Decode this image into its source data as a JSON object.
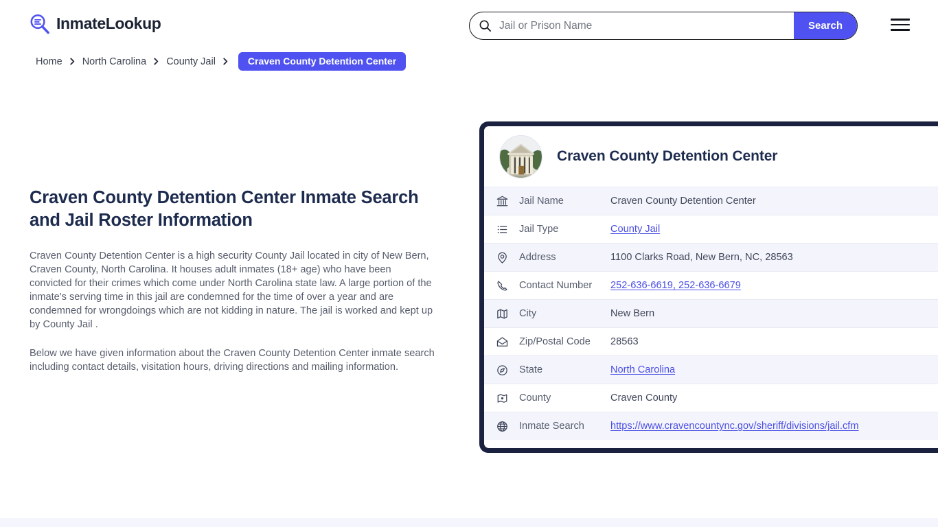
{
  "brand": {
    "name": "InmateLookup",
    "logo_icon": "magnifier-list-icon",
    "accent_color": "#4f52f0"
  },
  "header": {
    "search": {
      "placeholder": "Jail or Prison Name",
      "value": "",
      "icon": "search-icon",
      "button_label": "Search"
    },
    "menu_icon": "hamburger-menu-icon"
  },
  "breadcrumb": {
    "items": [
      {
        "label": "Home",
        "current": false
      },
      {
        "label": "North Carolina",
        "current": false
      },
      {
        "label": "County Jail",
        "current": false
      },
      {
        "label": "Craven County Detention Center",
        "current": true
      }
    ],
    "separator_icon": "chevron-right-icon"
  },
  "main": {
    "title": "Craven County Detention Center Inmate Search and Jail Roster Information",
    "paragraphs": [
      "Craven County Detention Center is a high security County Jail located in city of New Bern, Craven County, North Carolina. It houses adult inmates (18+ age) who have been convicted for their crimes which come under North Carolina state law. A large portion of the inmate's serving time in this jail are condemned for the time of over a year and are condemned for wrongdoings which are not kidding in nature. The jail is worked and kept up by County Jail .",
      "Below we have given information about the Craven County Detention Center inmate search including contact details, visitation hours, driving directions and mailing information."
    ]
  },
  "info_card": {
    "title": "Craven County Detention Center",
    "thumbnail_icon": "courthouse-building-photo",
    "border_color": "#1b2240",
    "rows": [
      {
        "icon": "bank-icon",
        "label": "Jail Name",
        "value": "Craven County Detention Center",
        "link": false,
        "shaded": true
      },
      {
        "icon": "list-icon",
        "label": "Jail Type",
        "value": "County Jail",
        "link": true,
        "shaded": false
      },
      {
        "icon": "map-pin-icon",
        "label": "Address",
        "value": "1100 Clarks Road, New Bern, NC, 28563",
        "link": false,
        "shaded": true
      },
      {
        "icon": "phone-icon",
        "label": "Contact Number",
        "value": "252-636-6619, 252-636-6679",
        "link": true,
        "shaded": false
      },
      {
        "icon": "map-icon",
        "label": "City",
        "value": "New Bern",
        "link": false,
        "shaded": true
      },
      {
        "icon": "envelope-icon",
        "label": "Zip/Postal Code",
        "value": "28563",
        "link": false,
        "shaded": false
      },
      {
        "icon": "globe-compass-icon",
        "label": "State",
        "value": "North Carolina",
        "link": true,
        "shaded": true
      },
      {
        "icon": "map-dot-icon",
        "label": "County",
        "value": "Craven County",
        "link": false,
        "shaded": false
      },
      {
        "icon": "globe-icon",
        "label": "Inmate Search",
        "value": "https://www.cravencountync.gov/sheriff/divisions/jail.cfm",
        "link": true,
        "shaded": true
      }
    ]
  }
}
